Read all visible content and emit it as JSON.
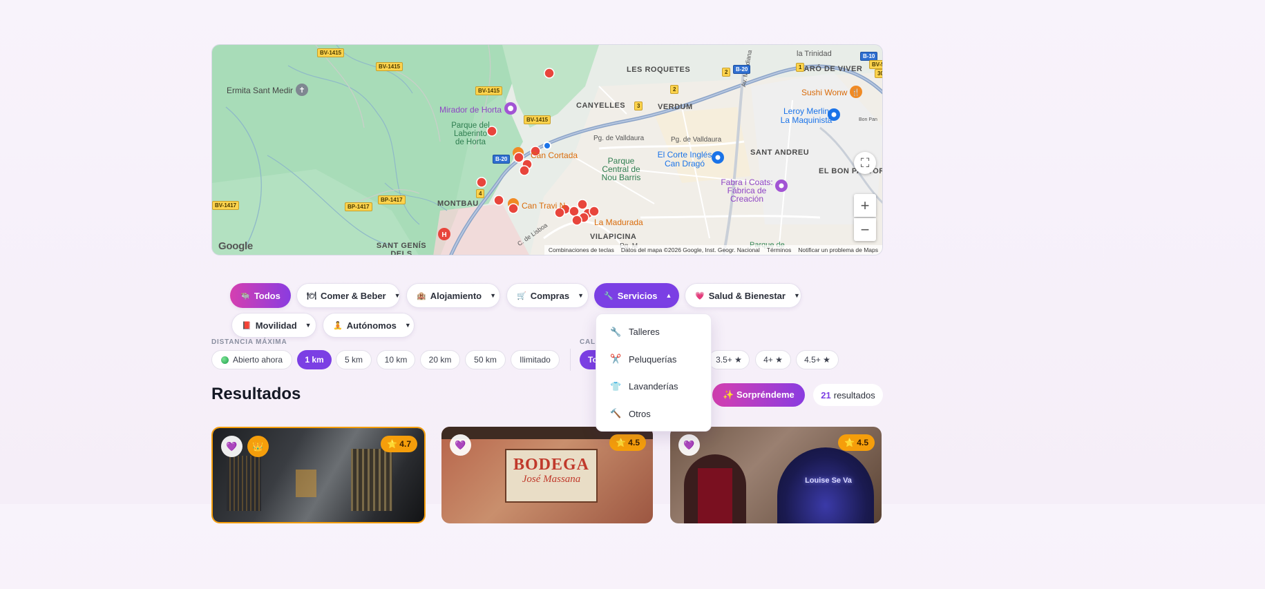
{
  "map": {
    "labels": {
      "les_roquetes": "LES ROQUETES",
      "baro_de_viver": "BARÓ DE VIVER",
      "la_trinidad": "la Trinidad",
      "ermita": "Ermita Sant Medir",
      "mirador": "Mirador de Horta",
      "canyelles": "CANYELLES",
      "verdum": "VERDUM",
      "sushi": "Sushi Wonw",
      "leroy": "Leroy Merlin La Maquinista",
      "parque_laberinto": "Parque del Laberinto de Horta",
      "can_cortada": "Can Cortada",
      "valldaura1": "Pg. de Valldaura",
      "valldaura2": "Pg. de Valldaura",
      "corte_ingles": "El Corte Inglés Can Dragó",
      "sant_andreu": "SANT ANDREU",
      "bon_pastor": "EL BON PASTOR",
      "parque_nou_barris": "Parque Central de Nou Barris",
      "fabra": "Fabra i Coats: Fábrica de Creación",
      "montbau": "MONTBAU",
      "can_travi": "Can Travi N",
      "la_madurada": "La Madurada",
      "vilapicina": "VILAPICINA",
      "sant_genis": "SANT GENÍS DELS AGUDELLS",
      "av_meridiana": "Av. Meridiana",
      "c_lisboa": "C. de Lisboa",
      "parque_de": "Parque de",
      "pg_m": "Pg. M",
      "bon_pan": "Bon Pan"
    },
    "roads": {
      "bv1415": "BV-1415",
      "bp1417": "BP-1417",
      "bv1417": "BV-1417",
      "b20": "B-20",
      "b10": "B-10",
      "bv50": "BV-50",
      "n3": "3",
      "n2": "2",
      "n4": "4",
      "n1": "1",
      "n30": "30"
    },
    "google": "Google",
    "footer": {
      "shortcuts": "Combinaciones de teclas",
      "data": "Datos del mapa ©2026 Google, Inst. Geogr. Nacional",
      "terms": "Términos",
      "report": "Notificar un problema de Maps"
    },
    "controls": {
      "fullscreen": "⛶",
      "zoom_in": "+",
      "zoom_out": "−"
    }
  },
  "categories": [
    {
      "label": "Todos",
      "icon": "🐃",
      "active": true
    },
    {
      "label": "Comer & Beber",
      "icon": "🍽",
      "caret": "▼"
    },
    {
      "label": "Alojamiento",
      "icon": "🏨",
      "caret": "▼"
    },
    {
      "label": "Compras",
      "icon": "🛒",
      "caret": "▼"
    },
    {
      "label": "Servicios",
      "icon": "🔧",
      "caret": "▲",
      "open": true
    },
    {
      "label": "Salud & Bienestar",
      "icon": "💗",
      "caret": "▼"
    },
    {
      "label": "Movilidad",
      "icon": "📕",
      "caret": "▼"
    },
    {
      "label": "Autónomos",
      "icon": "🧘",
      "caret": "▼"
    }
  ],
  "services_menu": [
    {
      "label": "Talleres",
      "icon": "🔧"
    },
    {
      "label": "Peluquerías",
      "icon": "✂️"
    },
    {
      "label": "Lavanderías",
      "icon": "👕"
    },
    {
      "label": "Otros",
      "icon": "🔨"
    }
  ],
  "filters": {
    "distance_label": "DISTANCIA MÁXIMA",
    "rating_label": "CAL",
    "open_now": "Abierto ahora",
    "distances": [
      "1 km",
      "5 km",
      "10 km",
      "20 km",
      "50 km",
      "Ilimitado"
    ],
    "active_distance": "1 km",
    "rating_partial": "To",
    "ratings": [
      "3.5+ ★",
      "4+ ★",
      "4.5+ ★"
    ]
  },
  "results": {
    "title": "Resultados",
    "surprise": "✨ Sorpréndeme",
    "count": "21",
    "count_label": "resultados"
  },
  "cards": [
    {
      "rating": "⭐ 4.7",
      "fav_icon": "💜",
      "crown_icon": "👑",
      "highlighted": true
    },
    {
      "rating": "⭐ 4.5",
      "fav_icon": "💜",
      "sign": "BODEGA",
      "sign2": "José Massana"
    },
    {
      "rating": "⭐ 4.5",
      "fav_icon": "💜",
      "neon": "Louise Se Va"
    }
  ]
}
